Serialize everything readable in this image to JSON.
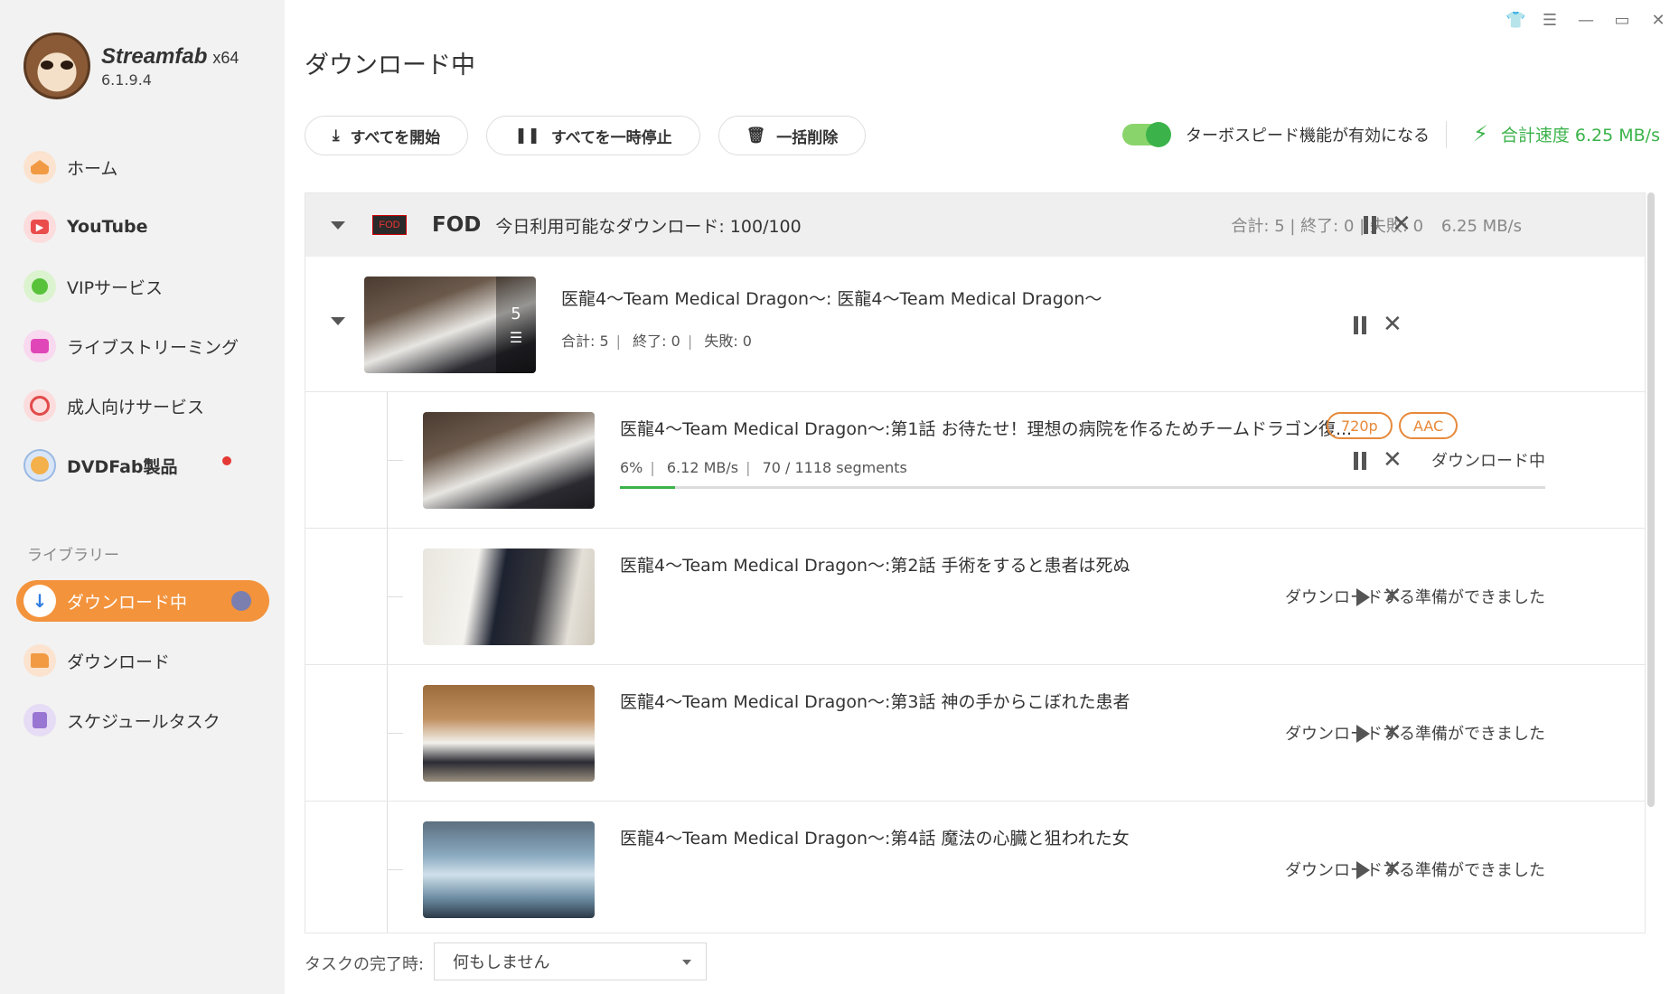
{
  "window_controls": [
    "shirt-icon",
    "menu-icon",
    "minimize-icon",
    "maximize-icon",
    "close-icon"
  ],
  "brand": {
    "name": "Streamfab",
    "arch": "x64",
    "version": "6.1.9.4"
  },
  "sidebar": {
    "items": [
      {
        "label": "ホーム",
        "icon": "home-icon"
      },
      {
        "label": "YouTube",
        "icon": "youtube-icon"
      },
      {
        "label": "VIPサービス",
        "icon": "key-icon"
      },
      {
        "label": "ライブストリーミング",
        "icon": "video-camera-icon"
      },
      {
        "label": "成人向けサービス",
        "icon": "adult-icon"
      },
      {
        "label": "DVDFab製品",
        "icon": "dvdfab-icon"
      }
    ],
    "library_label": "ライブラリー",
    "library": [
      {
        "label": "ダウンロード中",
        "icon": "download-arrow-icon",
        "active": true
      },
      {
        "label": "ダウンロード",
        "icon": "folder-icon"
      },
      {
        "label": "スケジュールタスク",
        "icon": "schedule-icon"
      }
    ]
  },
  "main": {
    "title": "ダウンロード中",
    "toolbar": {
      "start_all": "すべてを開始",
      "pause_all": "すべてを一時停止",
      "delete_all": "一括削除"
    },
    "turbo_label": "ターボスピード機能が有効になる",
    "total_speed": "合計速度 6.25 MB/s",
    "accent_color": "#3bb34a",
    "active_color": "#f3933c"
  },
  "group": {
    "service": "FOD",
    "logo_text": "FOD",
    "quota": "今日利用可能なダウンロード: 100/100",
    "stats": "合計: 5 | 終了: 0 | 失敗: 0",
    "speed": "6.25 MB/s"
  },
  "parent": {
    "title": "医龍4～Team Medical Dragon～: 医龍4～Team Medical Dragon～",
    "count": "5",
    "total": "合計: 5",
    "done": "終了: 0",
    "failed": "失敗: 0"
  },
  "episodes": [
    {
      "title": "医龍4～Team Medical Dragon～:第1話 お待たせ！理想の病院を作るためチームドラゴン復...",
      "resolution": "720p",
      "audio": "AAC",
      "status": "ダウンロード中",
      "percent_text": "6%",
      "progress": 0.06,
      "speed": "6.12 MB/s",
      "segments": "70 / 1118 segments"
    },
    {
      "title": "医龍4～Team Medical Dragon～:第2話 手術をすると患者は死ぬ",
      "status": "ダウンロードする準備ができました"
    },
    {
      "title": "医龍4～Team Medical Dragon～:第3話 神の手からこぼれた患者",
      "status": "ダウンロードする準備ができました"
    },
    {
      "title": "医龍4～Team Medical Dragon～:第4話 魔法の心臓と狙われた女",
      "status": "ダウンロードする準備ができました"
    }
  ],
  "footer": {
    "label": "タスクの完了時:",
    "select_value": "何もしません"
  }
}
